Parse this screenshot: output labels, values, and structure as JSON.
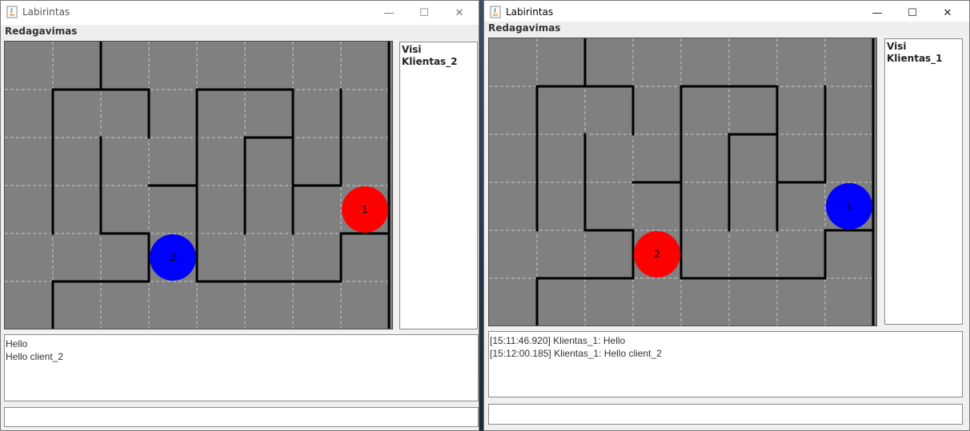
{
  "windows": [
    {
      "title": "Labirintas",
      "menu": "Redagavimas",
      "users": [
        "Visi",
        "Klientas_2"
      ],
      "chat": [
        "Hello",
        "Hello client_2"
      ],
      "input_value": "",
      "players": [
        {
          "label": "1",
          "color": "#ff0000",
          "col": 7,
          "row": 3
        },
        {
          "label": "2",
          "color": "#0000ff",
          "col": 3,
          "row": 4
        }
      ]
    },
    {
      "title": "Labirintas",
      "menu": "Redagavimas",
      "users": [
        "Visi",
        "Klientas_1"
      ],
      "chat": [
        "[15:11:46.920] Klientas_1: Hello",
        "[15:12:00.185] Klientas_1: Hello client_2"
      ],
      "input_value": "",
      "players": [
        {
          "label": "1",
          "color": "#0000ff",
          "col": 7,
          "row": 3
        },
        {
          "label": "2",
          "color": "#ff0000",
          "col": 3,
          "row": 4
        }
      ]
    }
  ],
  "maze": {
    "cols": 8,
    "rows": 6,
    "walls": [
      [
        2,
        0,
        2,
        1
      ],
      [
        1,
        1,
        3,
        1
      ],
      [
        1,
        1,
        1,
        4
      ],
      [
        3,
        1,
        3,
        2
      ],
      [
        2,
        2,
        2,
        4
      ],
      [
        2,
        4,
        3,
        4
      ],
      [
        3,
        4,
        3,
        5
      ],
      [
        1,
        5,
        3,
        5
      ],
      [
        1,
        5,
        1,
        6
      ],
      [
        3,
        3,
        4,
        3
      ],
      [
        4,
        1,
        4,
        3
      ],
      [
        4,
        1,
        6,
        1
      ],
      [
        6,
        1,
        6,
        3
      ],
      [
        5,
        2,
        6,
        2
      ],
      [
        5,
        2,
        5,
        4
      ],
      [
        6,
        3,
        7,
        3
      ],
      [
        6,
        3,
        6,
        4
      ],
      [
        4,
        5,
        7,
        5
      ],
      [
        7,
        4,
        7,
        5
      ],
      [
        7,
        4,
        8,
        4
      ],
      [
        7,
        1,
        7,
        3
      ],
      [
        4,
        3,
        4,
        5
      ],
      [
        8,
        0,
        8,
        6
      ]
    ]
  },
  "icons": {
    "app": "java-icon",
    "minimize": "minimize-icon",
    "maximize": "maximize-icon",
    "close": "close-icon"
  }
}
